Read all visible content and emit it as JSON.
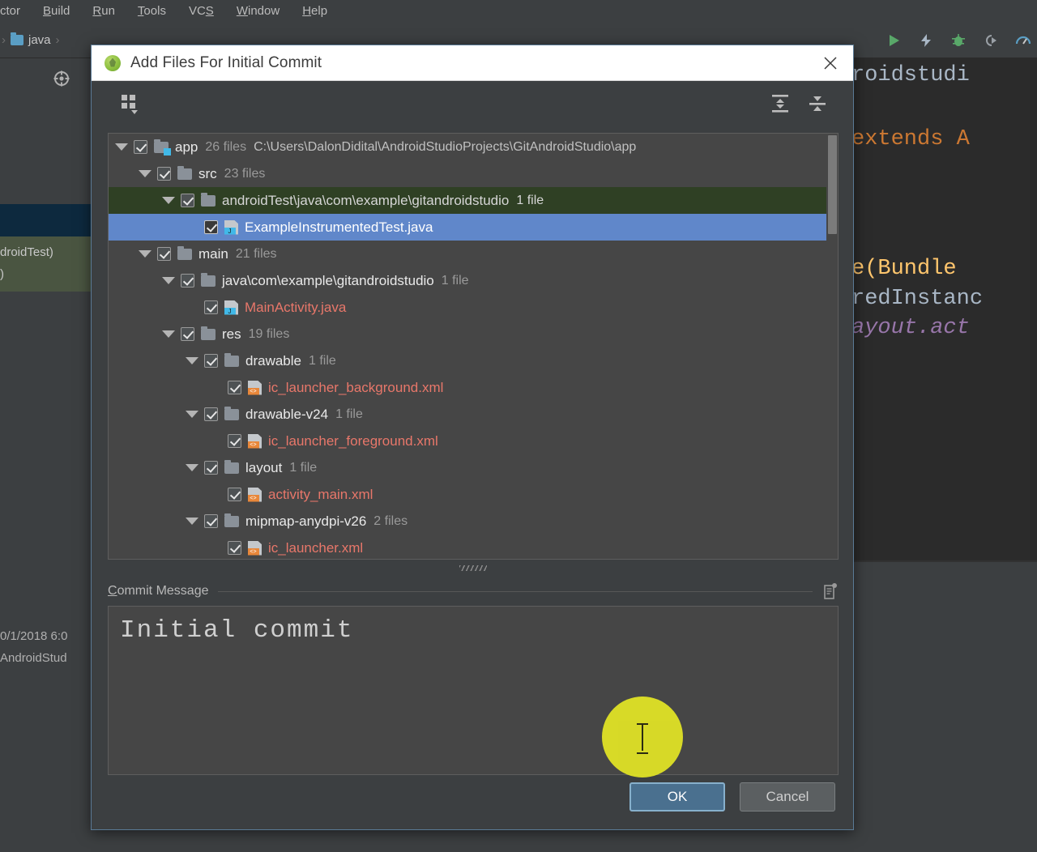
{
  "ide": {
    "menubar": [
      {
        "label": "ctor",
        "mnemonic": ""
      },
      {
        "label": "Build",
        "mnemonic": "B"
      },
      {
        "label": "Run",
        "mnemonic": "R"
      },
      {
        "label": "Tools",
        "mnemonic": "T"
      },
      {
        "label": "VCS",
        "mnemonic": "S"
      },
      {
        "label": "Window",
        "mnemonic": "W"
      },
      {
        "label": "Help",
        "mnemonic": "H"
      }
    ],
    "breadcrumb": [
      "java"
    ],
    "toolbar_icons": [
      "run-icon",
      "apply-changes-icon",
      "debug-icon",
      "attach-debugger-icon",
      "profiler-icon"
    ],
    "left_panel": {
      "green_row_line1": "droidTest)",
      "green_row_line2": ")",
      "bottom_line1": "0/1/2018 6:0",
      "bottom_line2": "AndroidStud"
    },
    "editor_code": [
      {
        "text": "roidstudi",
        "style": "default"
      },
      {
        "text": "extends A",
        "style": "keyword-mixed"
      },
      {
        "text": "e(Bundle",
        "style": "fn-mixed"
      },
      {
        "text": "redInstanc",
        "style": "default"
      },
      {
        "text": "ayout.act",
        "style": "field-mixed"
      }
    ]
  },
  "dialog": {
    "title": "Add Files For Initial Commit",
    "logo_icon": "android-studio-icon",
    "close_icon": "close-icon",
    "toolbar": {
      "group_by_icon": "group-by-icon",
      "expand_all_icon": "expand-all-icon",
      "collapse_all_icon": "collapse-all-icon"
    },
    "tree": [
      {
        "indent": 0,
        "arrow": true,
        "checked": true,
        "icon": "folder-modified-icon",
        "name": "app",
        "name_color": "white",
        "count": "26 files",
        "path": "C:\\Users\\DalonDidital\\AndroidStudioProjects\\GitAndroidStudio\\app",
        "highlight": "none"
      },
      {
        "indent": 1,
        "arrow": true,
        "checked": true,
        "icon": "folder-icon",
        "name": "src",
        "name_color": "white",
        "count": "23 files",
        "path": "",
        "highlight": "none"
      },
      {
        "indent": 2,
        "arrow": true,
        "checked": true,
        "icon": "folder-icon",
        "name": "androidTest\\java\\com\\example\\gitandroidstudio",
        "name_color": "white",
        "count": "1 file",
        "path": "",
        "highlight": "green"
      },
      {
        "indent": 3,
        "arrow": false,
        "checked": true,
        "icon": "java-file-icon",
        "name": "ExampleInstrumentedTest.java",
        "name_color": "white",
        "count": "",
        "path": "",
        "highlight": "blue"
      },
      {
        "indent": 1,
        "arrow": true,
        "checked": true,
        "icon": "folder-icon",
        "name": "main",
        "name_color": "white",
        "count": "21 files",
        "path": "",
        "highlight": "none"
      },
      {
        "indent": 2,
        "arrow": true,
        "checked": true,
        "icon": "folder-icon",
        "name": "java\\com\\example\\gitandroidstudio",
        "name_color": "white",
        "count": "1 file",
        "path": "",
        "highlight": "none"
      },
      {
        "indent": 3,
        "arrow": false,
        "checked": true,
        "icon": "java-file-icon",
        "name": "MainActivity.java",
        "name_color": "red",
        "count": "",
        "path": "",
        "highlight": "none"
      },
      {
        "indent": 2,
        "arrow": true,
        "checked": true,
        "icon": "folder-icon",
        "name": "res",
        "name_color": "white",
        "count": "19 files",
        "path": "",
        "highlight": "none"
      },
      {
        "indent": 3,
        "arrow": true,
        "checked": true,
        "icon": "folder-icon",
        "name": "drawable",
        "name_color": "white",
        "count": "1 file",
        "path": "",
        "highlight": "none"
      },
      {
        "indent": 4,
        "arrow": false,
        "checked": true,
        "icon": "xml-file-icon",
        "name": "ic_launcher_background.xml",
        "name_color": "red",
        "count": "",
        "path": "",
        "highlight": "none"
      },
      {
        "indent": 3,
        "arrow": true,
        "checked": true,
        "icon": "folder-icon",
        "name": "drawable-v24",
        "name_color": "white",
        "count": "1 file",
        "path": "",
        "highlight": "none"
      },
      {
        "indent": 4,
        "arrow": false,
        "checked": true,
        "icon": "xml-file-icon",
        "name": "ic_launcher_foreground.xml",
        "name_color": "red",
        "count": "",
        "path": "",
        "highlight": "none"
      },
      {
        "indent": 3,
        "arrow": true,
        "checked": true,
        "icon": "folder-icon",
        "name": "layout",
        "name_color": "white",
        "count": "1 file",
        "path": "",
        "highlight": "none"
      },
      {
        "indent": 4,
        "arrow": false,
        "checked": true,
        "icon": "xml-file-icon",
        "name": "activity_main.xml",
        "name_color": "red",
        "count": "",
        "path": "",
        "highlight": "none"
      },
      {
        "indent": 3,
        "arrow": true,
        "checked": true,
        "icon": "folder-icon",
        "name": "mipmap-anydpi-v26",
        "name_color": "white",
        "count": "2 files",
        "path": "",
        "highlight": "none"
      },
      {
        "indent": 4,
        "arrow": false,
        "checked": true,
        "icon": "xml-file-icon",
        "name": "ic_launcher.xml",
        "name_color": "red",
        "count": "",
        "path": "",
        "highlight": "none"
      }
    ],
    "commit_message": {
      "label_mnemonic": "C",
      "label_rest": "ommit Message",
      "history_icon": "commit-history-icon",
      "value": "Initial commit"
    },
    "buttons": {
      "ok": "OK",
      "cancel": "Cancel"
    }
  },
  "cursor": {
    "icon": "text-cursor-ibeam",
    "highlight_color": "#e3e525"
  }
}
